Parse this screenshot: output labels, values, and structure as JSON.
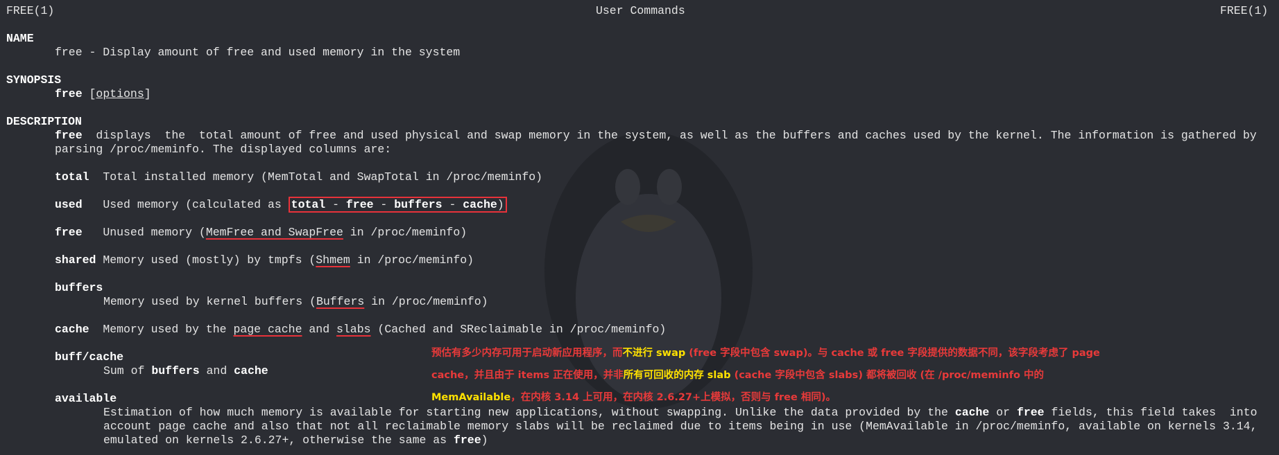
{
  "header": {
    "left": "FREE(1)",
    "center": "User Commands",
    "right": "FREE(1)"
  },
  "name": {
    "heading": "NAME",
    "text": "free - Display amount of free and used memory in the system"
  },
  "synopsis": {
    "heading": "SYNOPSIS",
    "cmd": "free",
    "open": " [",
    "opt": "options",
    "close": "]"
  },
  "description": {
    "heading": "DESCRIPTION",
    "line1_cmd": "free",
    "line1_rest": "  displays  the  total amount of free and used physical and swap memory in the system, as well as the buffers and caches used by the kernel. The information is gathered by",
    "line2": "parsing /proc/meminfo. The displayed columns are:"
  },
  "columns": {
    "total": {
      "term": "total",
      "desc": "  Total installed memory (MemTotal and SwapTotal in /proc/meminfo)"
    },
    "used": {
      "term": "used",
      "pre": "   Used memory (calculated as ",
      "t1": "total",
      "s1": " - ",
      "t2": "free",
      "s2": " - ",
      "t3": "buffers",
      "s3": " - ",
      "t4": "cache",
      "post": ")"
    },
    "free": {
      "term": "free",
      "pre": "   Unused memory (",
      "hl": "MemFree and SwapFree",
      "post": " in /proc/meminfo)"
    },
    "shared": {
      "term": "shared",
      "pre": " Memory used (mostly) by tmpfs (",
      "hl": "Shmem",
      "post": " in /proc/meminfo)"
    },
    "buffers": {
      "term": "buffers",
      "pre": "Memory used by kernel buffers (",
      "hl": "Buffers",
      "post": " in /proc/meminfo)"
    },
    "cache": {
      "term": "cache",
      "pre": "  Memory used by the ",
      "hl1": "page cache",
      "mid": " and ",
      "hl2": "slabs",
      "post": " (Cached and SReclaimable in /proc/meminfo)"
    },
    "buffcache": {
      "term": "buff/cache",
      "pre": "Sum of ",
      "b1": "buffers",
      "mid": " and ",
      "b2": "cache"
    },
    "available": {
      "term": "available",
      "l1_pre": "Estimation of how much memory is available for starting new applications, without swapping. Unlike the data provided by the ",
      "l1_b1": "cache",
      "l1_mid": " or ",
      "l1_b2": "free",
      "l1_post": " fields, this field takes  into",
      "l2": "account page cache and also that not all reclaimable memory slabs will be reclaimed due to items being in use (MemAvailable in /proc/meminfo, available on kernels 3.14,",
      "l3_pre": "emulated on kernels 2.6.27+, otherwise the same as ",
      "l3_b": "free",
      "l3_post": ")"
    }
  },
  "annotation": {
    "a1": "预估有多少内存可用于启动新应用程序，而",
    "a1y1": "不进行 swap",
    "a1b": " (free 字段中包含 swap)。与 cache 或 free 字段提供的数据不同，该字段考虑了 page",
    "a2": "cache，并且由于 items 正在使用，并非",
    "a2y": "所有可回收的内存 slab",
    "a2b": " (cache 字段中包含 slabs) 都将被回收 (在 /proc/meminfo 中的",
    "a3y": "MemAvailable",
    "a3b": "，在内核 3.14 上可用，在内核 2.6.27+上模拟，否则与 free 相同)。"
  },
  "colors": {
    "background": "#2b2d33",
    "accent": "#e8323a",
    "highlight": "#ffe100"
  }
}
